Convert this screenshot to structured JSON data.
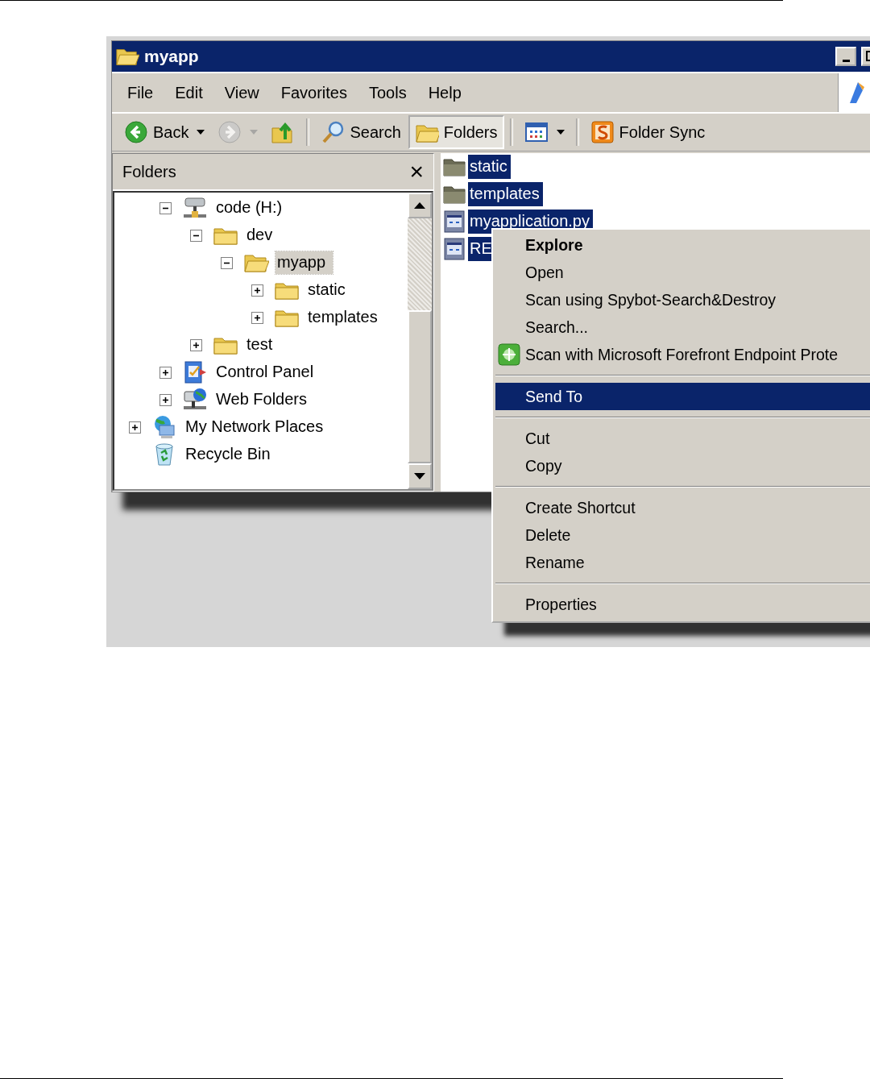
{
  "window": {
    "title": "myapp"
  },
  "menu_bar": [
    {
      "label": "File"
    },
    {
      "label": "Edit"
    },
    {
      "label": "View"
    },
    {
      "label": "Favorites"
    },
    {
      "label": "Tools"
    },
    {
      "label": "Help"
    }
  ],
  "toolbar": [
    {
      "kind": "back",
      "label": "Back",
      "dropdown": true,
      "disabled": false,
      "pressed": false
    },
    {
      "kind": "forward",
      "dropdown": true,
      "disabled": true,
      "pressed": false
    },
    {
      "kind": "up",
      "dropdown": false,
      "disabled": false,
      "pressed": false
    },
    {
      "kind": "separator"
    },
    {
      "kind": "search",
      "label": "Search",
      "dropdown": false,
      "disabled": false,
      "pressed": false
    },
    {
      "kind": "folders",
      "label": "Folders",
      "dropdown": false,
      "disabled": false,
      "pressed": true
    },
    {
      "kind": "separator"
    },
    {
      "kind": "views",
      "dropdown": true,
      "disabled": false,
      "pressed": false
    },
    {
      "kind": "separator"
    },
    {
      "kind": "sync",
      "label": "Folder Sync",
      "dropdown": false,
      "disabled": false,
      "pressed": false
    }
  ],
  "folders_pane": {
    "title": "Folders",
    "close": "×",
    "tree": [
      {
        "children": [
          {
            "label": "code (H:)",
            "kind": "drive",
            "expanded": true,
            "selected": false,
            "children": [
              {
                "label": "dev",
                "kind": "folder",
                "expanded": true,
                "selected": false,
                "children": [
                  {
                    "label": "myapp",
                    "kind": "open-folder",
                    "expanded": true,
                    "selected": true,
                    "children": [
                      {
                        "label": "static",
                        "kind": "folder",
                        "expanded": false,
                        "selected": false
                      },
                      {
                        "label": "templates",
                        "kind": "folder",
                        "expanded": false,
                        "selected": false
                      }
                    ]
                  }
                ]
              },
              {
                "label": "test",
                "kind": "folder",
                "expanded": false,
                "selected": false
              }
            ]
          },
          {
            "label": "Control Panel",
            "kind": "control-panel",
            "expanded": false,
            "selected": false
          },
          {
            "label": "Web Folders",
            "kind": "web-folders",
            "expanded": false,
            "selected": false
          }
        ]
      },
      {
        "label": "My Network Places",
        "kind": "network",
        "expanded": false,
        "selected": false
      },
      {
        "label": "Recycle Bin",
        "kind": "recycle",
        "selected": false
      }
    ]
  },
  "files": [
    {
      "name": "static",
      "kind": "folder",
      "selected": true
    },
    {
      "name": "templates",
      "kind": "folder",
      "selected": true
    },
    {
      "name": "myapplication.py",
      "kind": "file",
      "selected": true
    },
    {
      "name": "RE",
      "kind": "file",
      "selected": true
    }
  ],
  "context_menu": [
    {
      "kind": "item",
      "label": "Explore",
      "default": true,
      "selected": false
    },
    {
      "kind": "item",
      "label": "Open",
      "default": false,
      "selected": false
    },
    {
      "kind": "item",
      "label": "Scan using Spybot-Search&Destroy",
      "default": false,
      "selected": false
    },
    {
      "kind": "item",
      "label": "Search...",
      "default": false,
      "selected": false
    },
    {
      "kind": "shield-item",
      "label": "Scan with Microsoft Forefront Endpoint Prote",
      "default": false,
      "selected": false
    },
    {
      "kind": "separator"
    },
    {
      "kind": "item",
      "label": "Send To",
      "default": false,
      "selected": true
    },
    {
      "kind": "separator"
    },
    {
      "kind": "item",
      "label": "Cut",
      "default": false,
      "selected": false
    },
    {
      "kind": "item",
      "label": "Copy",
      "default": false,
      "selected": false
    },
    {
      "kind": "separator"
    },
    {
      "kind": "item",
      "label": "Create Shortcut",
      "default": false,
      "selected": false
    },
    {
      "kind": "item",
      "label": "Delete",
      "default": false,
      "selected": false
    },
    {
      "kind": "item",
      "label": "Rename",
      "default": false,
      "selected": false
    },
    {
      "kind": "separator"
    },
    {
      "kind": "item",
      "label": "Properties",
      "default": false,
      "selected": false
    }
  ]
}
